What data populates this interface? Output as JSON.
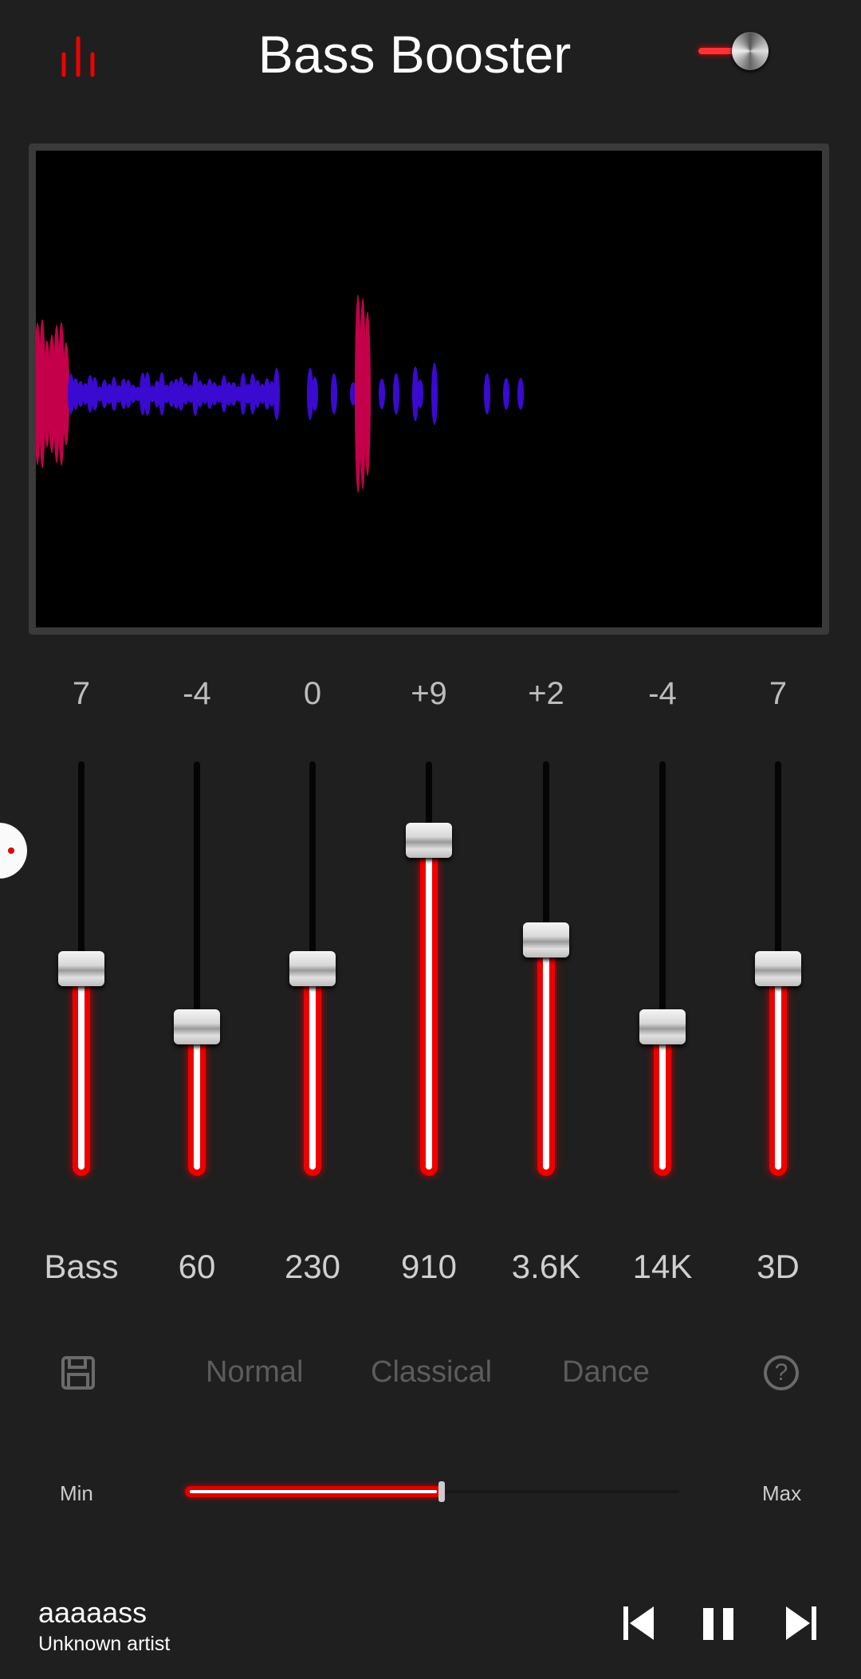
{
  "header": {
    "title": "Bass Booster",
    "menu_icon": "equalizer-bars-icon",
    "power_icon": "power-toggle-icon",
    "accent": "#e00000"
  },
  "visualizer": {
    "colors": [
      "#c4004a",
      "#3a0ad0"
    ]
  },
  "bands": [
    {
      "label": "Bass",
      "value": "7",
      "level": 0.5
    },
    {
      "label": "60",
      "value": "-4",
      "level": 0.36
    },
    {
      "label": "230",
      "value": "0",
      "level": 0.5
    },
    {
      "label": "910",
      "value": "+9",
      "level": 0.81
    },
    {
      "label": "3.6K",
      "value": "+2",
      "level": 0.57
    },
    {
      "label": "14K",
      "value": "-4",
      "level": 0.36
    },
    {
      "label": "3D",
      "value": "7",
      "level": 0.5
    }
  ],
  "presets": {
    "save_icon": "floppy-disk-icon",
    "items": [
      "Normal",
      "Classical",
      "Dance"
    ],
    "help_icon": "help-circle-icon"
  },
  "volume": {
    "min_label": "Min",
    "max_label": "Max",
    "level": 0.52
  },
  "player": {
    "title": "aaaaass",
    "artist": "Unknown artist"
  }
}
